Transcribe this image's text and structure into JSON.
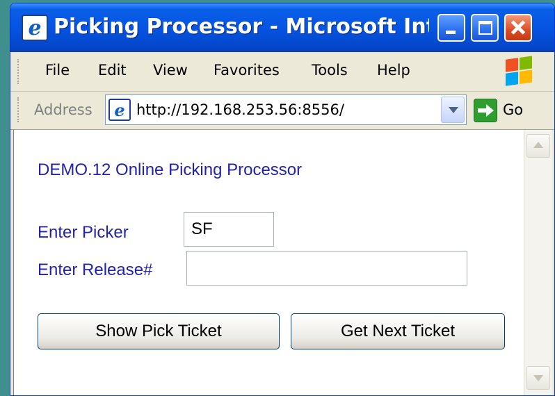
{
  "window": {
    "title": "Picking Processor - Microsoft Intern..."
  },
  "menu": {
    "items": [
      "File",
      "Edit",
      "View",
      "Favorites",
      "Tools",
      "Help"
    ]
  },
  "address_bar": {
    "label": "Address",
    "url": "http://192.168.253.56:8556/",
    "go_label": "Go"
  },
  "page": {
    "heading": "DEMO.12 Online Picking Processor",
    "picker_label": "Enter Picker",
    "picker_value": "SF",
    "release_label": "Enter Release#",
    "release_value": "",
    "show_button": "Show Pick Ticket",
    "next_button": "Get Next Ticket"
  },
  "icons": {
    "title": "ie-icon",
    "minimize": "minimize-icon",
    "maximize": "maximize-icon",
    "close": "close-icon",
    "brand": "windows-logo-icon",
    "address": "ie-page-icon",
    "dropdown": "chevron-down-icon",
    "go": "go-arrow-icon"
  },
  "colors": {
    "title_bar": "#0554e3",
    "close_button": "#de4a24",
    "page_text": "#2222aa",
    "desktop": "#3f8f8f"
  }
}
